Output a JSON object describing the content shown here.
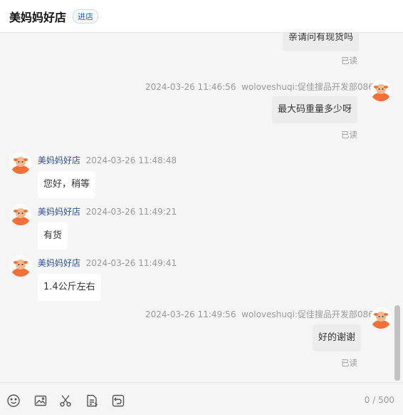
{
  "header": {
    "shop_name": "美妈妈好店",
    "enter_label": "进店"
  },
  "messages": [
    {
      "text": "亲请问有现货吗",
      "read": "已读"
    },
    {
      "time": "2024-03-26 11:46:56",
      "sender": "woloveshuqi:促佳搜品开发部086",
      "text": "最大码重量多少呀",
      "read": "已读"
    },
    {
      "sender": "美妈妈好店",
      "time": "2024-03-26 11:48:48",
      "text": "您好，稍等"
    },
    {
      "sender": "美妈妈好店",
      "time": "2024-03-26 11:49:21",
      "text": "有货"
    },
    {
      "sender": "美妈妈好店",
      "time": "2024-03-26 11:49:41",
      "text": "1.4公斤左右"
    },
    {
      "time": "2024-03-26 11:49:56",
      "sender": "woloveshuqi:促佳搜品开发部086",
      "text": "好的谢谢",
      "read": "已读"
    }
  ],
  "toolbar": {
    "icons": [
      "emoji-icon",
      "image-icon",
      "scissors-icon",
      "document-icon",
      "revoke-icon"
    ],
    "counter": "0 / 500"
  },
  "colors": {
    "accent_link": "#1f5fbf",
    "avatar_orange": "#f0703a",
    "bubble_mine": "#ececec",
    "bubble_theirs": "#ffffff"
  }
}
